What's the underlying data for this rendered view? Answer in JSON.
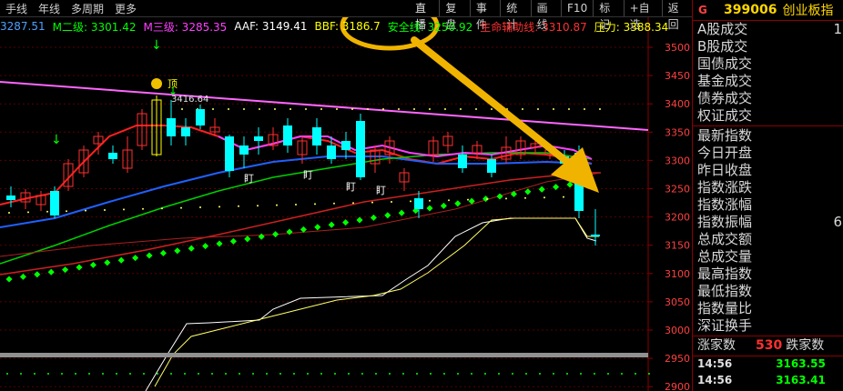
{
  "toolbar": {
    "left_items": [
      "手线",
      "年线",
      "多周期",
      "更多"
    ],
    "right_items": [
      "复盘",
      "事件",
      "统计",
      "画线",
      "F10",
      "标记",
      "+自选",
      "返回"
    ]
  },
  "indicators": [
    {
      "text": "3287.51",
      "color": "#4ea0ff"
    },
    {
      "text": "M二级: 3301.42",
      "color": "#00ff00"
    },
    {
      "text": "M三级: 3285.35",
      "color": "#ff00ff"
    },
    {
      "text": "AAF: 3149.41",
      "color": "#ffffff"
    },
    {
      "text": "BBF: 3186.7",
      "color": "#ffff00"
    },
    {
      "text": "安全线: 3250.92",
      "color": "#00ff00"
    },
    {
      "text": "生命辅助线: 3310.87",
      "color": "#ff3030"
    },
    {
      "text": "压力: 3388.34",
      "color": "#ffff00"
    }
  ],
  "annotations": {
    "peak_label": "3416.64",
    "peak_tag": "顶",
    "ding_marks": [
      "盯",
      "盯",
      "盯",
      "盯"
    ]
  },
  "price_axis": {
    "labels": [
      "3500",
      "3450",
      "3400",
      "3350",
      "3300",
      "3250",
      "3200",
      "3150",
      "3100",
      "3050",
      "3000",
      "2950",
      "2900"
    ]
  },
  "right_panel": {
    "badge": "G",
    "code": "399006",
    "name": "创业板指",
    "group1": [
      "A股成交",
      "B股成交",
      "国债成交",
      "基金成交",
      "债券成交",
      "权证成交"
    ],
    "group1_values": [
      "1",
      "",
      "",
      "",
      "",
      ""
    ],
    "group2": [
      "最新指数",
      "今日开盘",
      "昨日收盘",
      "指数涨跌",
      "指数涨幅",
      "指数振幅",
      "总成交额",
      "总成交量",
      "最高指数",
      "最低指数",
      "指数量比",
      "深证换手"
    ],
    "group2_values": [
      "",
      "",
      "",
      "",
      "",
      "6",
      "",
      "",
      "",
      "",
      "",
      ""
    ],
    "rise_label": "涨家数",
    "rise_value": "530",
    "fall_label": "跌家数",
    "ticks": [
      {
        "time": "14:56",
        "price": "3163.55"
      },
      {
        "time": "14:56",
        "price": "3163.41"
      }
    ]
  },
  "colors": {
    "up": "#ff3030",
    "down": "#00ffff",
    "highlight": "#f0b400",
    "grid_red": "#8b0000"
  }
}
